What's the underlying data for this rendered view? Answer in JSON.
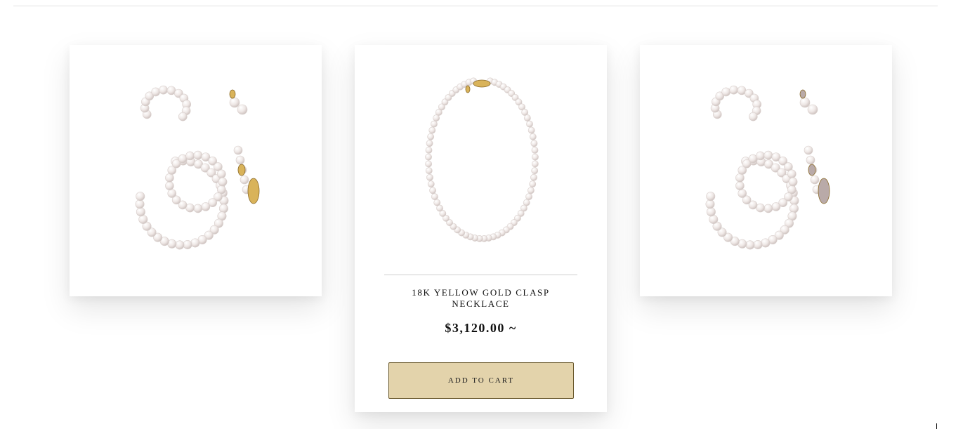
{
  "products": [
    {
      "image_alt": "pearl necklace bracelet and earrings set with yellow gold clasps",
      "metal": "yellow-gold"
    },
    {
      "title": "18K YELLOW GOLD CLASP NECKLACE",
      "price": "$3,120.00 ~",
      "add_to_cart_label": "ADD TO CART",
      "image_alt": "pearl strand necklace with yellow gold clasp"
    },
    {
      "image_alt": "pearl necklace bracelet and earrings set with white gold clasps",
      "metal": "white-gold"
    }
  ],
  "colors": {
    "button_bg": "#e3d3ab",
    "button_border": "#6b5a2e",
    "pearl": "#efe8e6",
    "gold": "#d9b35a",
    "white_gold": "#b9aaa8"
  }
}
